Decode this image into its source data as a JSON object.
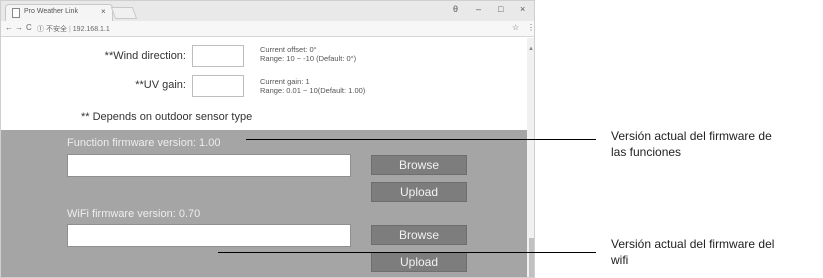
{
  "browser": {
    "tab_title": "Pro Weather Link",
    "tab_close": "×",
    "win_account": "θ",
    "win_min": "–",
    "win_max": "□",
    "win_close": "×",
    "nav_back": "←",
    "nav_forward": "→",
    "nav_reload": "C",
    "url_security": "① 不安全",
    "url_separator": "|",
    "url": "192.168.1.1",
    "star": "☆",
    "menu": "⋮"
  },
  "settings": {
    "wind": {
      "label": "**Wind direction:",
      "hint_line1": "Current offset: 0°",
      "hint_line2": "Range: 10 ~ -10 (Default: 0°)"
    },
    "uv": {
      "label": "**UV gain:",
      "hint_line1": "Current gain: 1",
      "hint_line2": "Range: 0.01 ~ 10(Default: 1.00)"
    },
    "note": "** Depends on outdoor sensor type"
  },
  "firmware": {
    "function": {
      "label": "Function firmware version: 1.00",
      "browse": "Browse",
      "upload": "Upload"
    },
    "wifi": {
      "label": "WiFi firmware version: 0.70",
      "browse": "Browse",
      "upload": "Upload"
    }
  },
  "annotations": {
    "function_line1": "Versión actual del firmware de",
    "function_line2": "las funciones",
    "wifi_line1": "Versión actual del firmware del",
    "wifi_line2": "wifi"
  }
}
